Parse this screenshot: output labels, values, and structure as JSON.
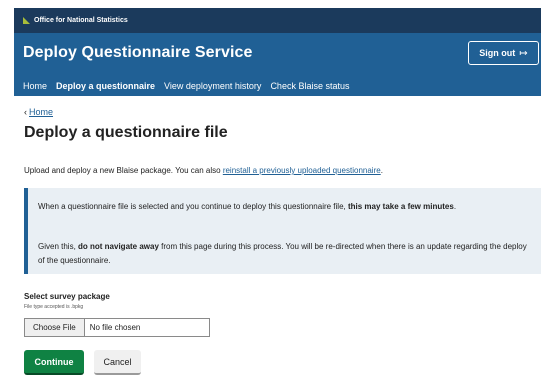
{
  "ons": {
    "logo_text": "Office for National Statistics"
  },
  "header": {
    "service_title": "Deploy Questionnaire Service",
    "signout_label": "Sign out",
    "signout_icon": "↦"
  },
  "nav": {
    "items": [
      {
        "label": "Home"
      },
      {
        "label": "Deploy a questionnaire"
      },
      {
        "label": "View deployment history"
      },
      {
        "label": "Check Blaise status"
      }
    ]
  },
  "breadcrumb": {
    "chevron": "‹",
    "label": "Home"
  },
  "page": {
    "title": "Deploy a questionnaire file",
    "intro_text": "Upload and deploy a new Blaise package. You can also ",
    "intro_link": "reinstall a previously uploaded questionnaire",
    "intro_end": "."
  },
  "panel": {
    "p1_a": "When a questionnaire file is selected and you continue to deploy this questionnaire file, ",
    "p1_b": "this may take a few minutes",
    "p1_c": ".",
    "p2_a": "Given this, ",
    "p2_b": "do not navigate away",
    "p2_c": " from this page during this process. You will be re-directed when there is an update regarding the deploy of the questionnaire."
  },
  "form": {
    "label": "Select survey package",
    "hint": "File type accepted is .bpkg",
    "choose_label": "Choose File",
    "file_status": "No file chosen",
    "continue_label": "Continue",
    "cancel_label": "Cancel"
  },
  "colors": {
    "ons_bar": "#1b3a5c",
    "header": "#206095",
    "link": "#206095",
    "panel": "#e9eff4",
    "continue": "#0f8243"
  }
}
